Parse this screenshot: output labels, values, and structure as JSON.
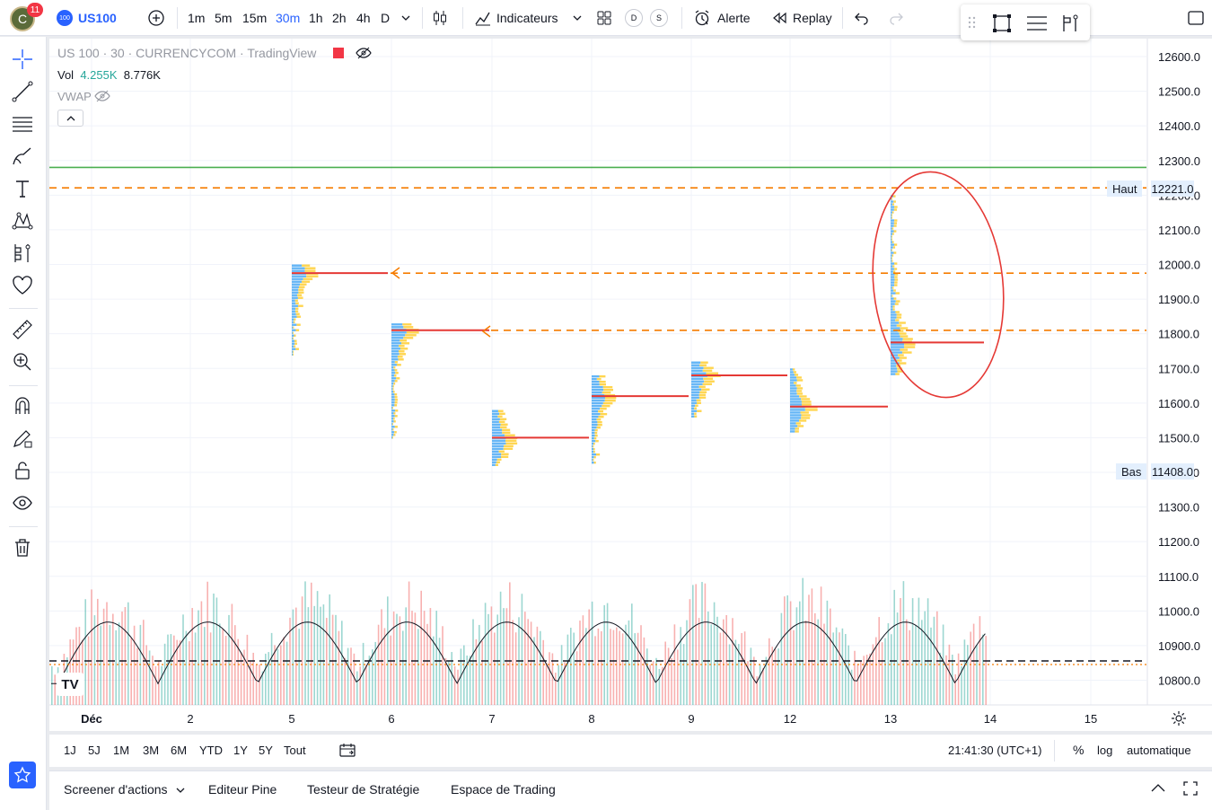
{
  "header": {
    "avatar_letter": "C",
    "notifications": "11",
    "symbol_logo": "100",
    "symbol": "US100",
    "timeframes": [
      {
        "label": "1m",
        "active": false
      },
      {
        "label": "5m",
        "active": false
      },
      {
        "label": "15m",
        "active": false
      },
      {
        "label": "30m",
        "active": true
      },
      {
        "label": "1h",
        "active": false
      },
      {
        "label": "2h",
        "active": false
      },
      {
        "label": "4h",
        "active": false
      },
      {
        "label": "D",
        "active": false
      }
    ],
    "indicators_label": "Indicateurs",
    "d_label": "D",
    "s_label": "S",
    "alert_label": "Alerte",
    "replay_label": "Replay"
  },
  "legend": {
    "title": "US 100 · 30 · CURRENCYCOM · TradingView",
    "vol_label": "Vol",
    "vol_value1": "4.255K",
    "vol_value2": "8.776K",
    "vwap_label": "VWAP"
  },
  "price_axis": {
    "ticks": [
      "12600.0",
      "12500.0",
      "12400.0",
      "12300.0",
      "12200.0",
      "12100.0",
      "12000.0",
      "11900.0",
      "11800.0",
      "11700.0",
      "11600.0",
      "11500.0",
      "11400.0",
      "11300.0",
      "11200.0",
      "11100.0",
      "11000.0",
      "10900.0",
      "10800.0"
    ],
    "high_label": "Haut",
    "high_value": "12221.0",
    "low_label": "Bas",
    "low_value": "11408.0"
  },
  "time_axis": [
    "Déc",
    "2",
    "5",
    "6",
    "7",
    "8",
    "9",
    "12",
    "13",
    "14",
    "15"
  ],
  "bottom_toolbar": {
    "ranges": [
      "1J",
      "5J",
      "1M",
      "3M",
      "6M",
      "YTD",
      "1Y",
      "5Y",
      "Tout"
    ],
    "clock": "21:41:30 (UTC+1)",
    "percent": "%",
    "log": "log",
    "auto": "automatique"
  },
  "bottom_panel": {
    "tabs": [
      "Screener d'actions",
      "Editeur Pine",
      "Testeur de Stratégie",
      "Espace de Trading"
    ]
  },
  "colors": {
    "accent": "#2962ff",
    "green_line": "#4caf50",
    "orange_dash": "#f57c00",
    "red_line": "#e53935",
    "vol_up": "#26a69a",
    "vol_down": "#ef5350",
    "profile_blue": "#64b5f6",
    "profile_yellow": "#ffd54f"
  },
  "chart_data": {
    "type": "volume-profile",
    "price_lines": {
      "resistance_green": 12280,
      "orange_dashed_levels": [
        12221,
        11975,
        11810
      ],
      "black_dashed_volume_level": 10855
    },
    "sessions": [
      {
        "day": "5",
        "poc": 11975
      },
      {
        "day": "6",
        "poc": 11810
      },
      {
        "day": "7",
        "poc": 11500
      },
      {
        "day": "8",
        "poc": 11620
      },
      {
        "day": "9",
        "poc": 11680
      },
      {
        "day": "12",
        "poc": 11590
      },
      {
        "day": "13",
        "poc": 11775
      }
    ]
  }
}
